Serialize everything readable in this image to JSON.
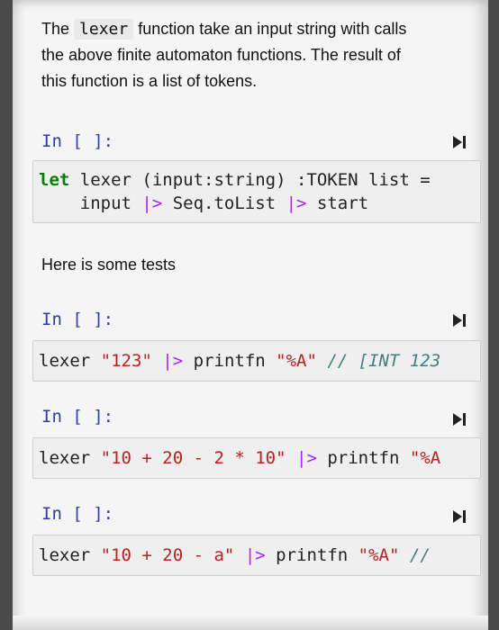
{
  "markdown1": {
    "part1": "The ",
    "code": "lexer",
    "part2": " function take an input string with calls",
    "line2": "the above finite automaton functions. The result of",
    "line3": "this function is a list of tokens."
  },
  "markdown2": {
    "text": "Here is some tests"
  },
  "cells": [
    {
      "prompt": "In [ ]:",
      "lines": [
        {
          "kw": "let",
          "rest": " lexer (input:string) :TOKEN list ="
        },
        {
          "indent": "    input ",
          "op1": "|>",
          "mid": " Seq.toList ",
          "op2": "|>",
          "end": " start"
        }
      ]
    },
    {
      "prompt": "In [ ]:",
      "line": {
        "a": "lexer ",
        "str1": "\"123\"",
        "b": " ",
        "op": "|>",
        "c": " printfn ",
        "str2": "\"%A\"",
        "d": " ",
        "comment": "// [INT 123"
      }
    },
    {
      "prompt": "In [ ]:",
      "line": {
        "a": "lexer ",
        "str1": "\"10 + 20 - 2 * 10\"",
        "b": " ",
        "op": "|>",
        "c": " printfn ",
        "str2": "\"%A"
      }
    },
    {
      "prompt": "In [ ]:",
      "line": {
        "a": "lexer ",
        "str1": "\"10 + 20 - a\"",
        "b": " ",
        "op": "|>",
        "c": " printfn ",
        "str2": "\"%A\"",
        "d": " ",
        "comment": "//"
      }
    }
  ],
  "icons": {
    "run": "run-cell-icon"
  }
}
